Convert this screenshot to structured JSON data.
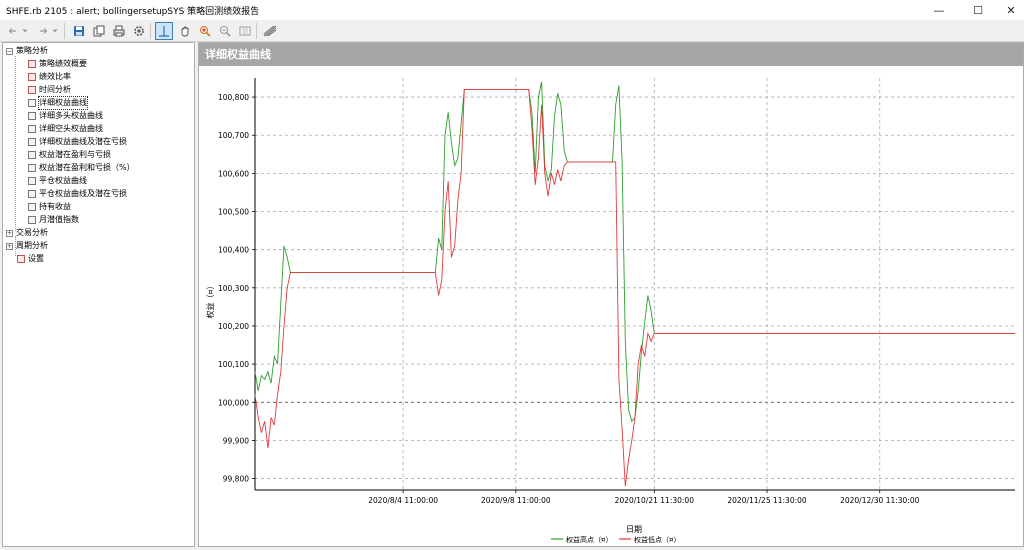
{
  "window": {
    "title": "SHFE.rb 2105 : alert; bollingersetupSYS 策略回测绩效报告",
    "minimize_glyph": "—",
    "maximize_glyph": "☐",
    "close_glyph": "✕"
  },
  "toolbar": {
    "icons": [
      "back-icon",
      "dropdown-icon",
      "forward-icon",
      "dropdown-icon",
      "save-icon",
      "copy-icon",
      "print-icon",
      "settings-icon",
      "crosshair-icon",
      "pan-icon",
      "zoom-in-icon",
      "zoom-out-icon",
      "reset-zoom-icon",
      "chart-style-icon"
    ]
  },
  "tree": {
    "root1": {
      "label": "策略分析",
      "expanded": true
    },
    "items": [
      "策略绩效概要",
      "绩效比率",
      "时间分析",
      "详细权益曲线",
      "详细多头权益曲线",
      "详细空头权益曲线",
      "详细权益曲线及潜在亏损",
      "权益潜在盈利与亏损",
      "权益潜在盈利和亏损（%）",
      "平仓权益曲线",
      "平仓权益曲线及潜在亏损",
      "持有收益",
      "月潜值指数"
    ],
    "selected_index": 3,
    "root2": {
      "label": "交易分析",
      "expanded": false
    },
    "root3": {
      "label": "周期分析",
      "expanded": false
    },
    "settings": {
      "label": "设置"
    }
  },
  "panel": {
    "title": "详细权益曲线"
  },
  "chart_data": {
    "type": "line",
    "xlabel": "日期",
    "ylabel": "权益（¤）",
    "ylim": [
      99770,
      100850
    ],
    "yticks": [
      99800,
      99900,
      100000,
      100100,
      100200,
      100300,
      100400,
      100500,
      100600,
      100700,
      100800
    ],
    "ytick_labels": [
      "99,800",
      "99,900",
      "100,000",
      "100,100",
      "100,200",
      "100,300",
      "100,400",
      "100,500",
      "100,600",
      "100,700",
      "100,800"
    ],
    "xlim": [
      "2020-06-19",
      "2021-02-10"
    ],
    "xticks": [
      "2020-08-04",
      "2020-09-08",
      "2020-10-21",
      "2020-11-25",
      "2020-12-30"
    ],
    "xtick_labels": [
      "2020/8/4 11:00:00",
      "2020/9/8 11:00:00",
      "2020/10/21 11:30:00",
      "2020/11/25 11:30:00",
      "2020/12/30 11:30:00"
    ],
    "grid": true,
    "legend_position": "bottom",
    "series": [
      {
        "name": "权益高点（¤）",
        "color": "#2e9e2e",
        "points": [
          [
            "2020-06-19",
            100080
          ],
          [
            "2020-06-20",
            100030
          ],
          [
            "2020-06-21",
            100070
          ],
          [
            "2020-06-22",
            100060
          ],
          [
            "2020-06-23",
            100080
          ],
          [
            "2020-06-24",
            100050
          ],
          [
            "2020-06-25",
            100120
          ],
          [
            "2020-06-26",
            100100
          ],
          [
            "2020-06-27",
            100260
          ],
          [
            "2020-06-28",
            100410
          ],
          [
            "2020-06-29",
            100380
          ],
          [
            "2020-06-30",
            100340
          ],
          [
            "2020-08-14",
            100340
          ],
          [
            "2020-08-15",
            100430
          ],
          [
            "2020-08-16",
            100400
          ],
          [
            "2020-08-17",
            100700
          ],
          [
            "2020-08-18",
            100760
          ],
          [
            "2020-08-19",
            100680
          ],
          [
            "2020-08-20",
            100620
          ],
          [
            "2020-08-21",
            100640
          ],
          [
            "2020-08-22",
            100730
          ],
          [
            "2020-08-23",
            100820
          ],
          [
            "2020-09-12",
            100820
          ],
          [
            "2020-09-13",
            100760
          ],
          [
            "2020-09-14",
            100600
          ],
          [
            "2020-09-15",
            100800
          ],
          [
            "2020-09-16",
            100840
          ],
          [
            "2020-09-17",
            100620
          ],
          [
            "2020-09-18",
            100580
          ],
          [
            "2020-09-19",
            100610
          ],
          [
            "2020-09-20",
            100750
          ],
          [
            "2020-09-21",
            100810
          ],
          [
            "2020-09-22",
            100780
          ],
          [
            "2020-09-23",
            100660
          ],
          [
            "2020-09-24",
            100630
          ],
          [
            "2020-10-08",
            100630
          ],
          [
            "2020-10-09",
            100780
          ],
          [
            "2020-10-10",
            100830
          ],
          [
            "2020-10-11",
            100630
          ],
          [
            "2020-10-12",
            100160
          ],
          [
            "2020-10-13",
            99980
          ],
          [
            "2020-10-14",
            99950
          ],
          [
            "2020-10-15",
            99960
          ],
          [
            "2020-10-16",
            100030
          ],
          [
            "2020-10-17",
            100130
          ],
          [
            "2020-10-18",
            100210
          ],
          [
            "2020-10-19",
            100280
          ],
          [
            "2020-10-20",
            100240
          ],
          [
            "2020-10-21",
            100180
          ],
          [
            "2021-02-10",
            100180
          ]
        ]
      },
      {
        "name": "权益低点（¤）",
        "color": "#e03a3a",
        "points": [
          [
            "2020-06-19",
            100020
          ],
          [
            "2020-06-20",
            99960
          ],
          [
            "2020-06-21",
            99920
          ],
          [
            "2020-06-22",
            99950
          ],
          [
            "2020-06-23",
            99880
          ],
          [
            "2020-06-24",
            99960
          ],
          [
            "2020-06-25",
            99940
          ],
          [
            "2020-06-26",
            100020
          ],
          [
            "2020-06-27",
            100080
          ],
          [
            "2020-06-28",
            100200
          ],
          [
            "2020-06-29",
            100300
          ],
          [
            "2020-06-30",
            100340
          ],
          [
            "2020-08-14",
            100340
          ],
          [
            "2020-08-15",
            100280
          ],
          [
            "2020-08-16",
            100320
          ],
          [
            "2020-08-17",
            100500
          ],
          [
            "2020-08-18",
            100580
          ],
          [
            "2020-08-19",
            100380
          ],
          [
            "2020-08-20",
            100410
          ],
          [
            "2020-08-21",
            100530
          ],
          [
            "2020-08-22",
            100600
          ],
          [
            "2020-08-23",
            100820
          ],
          [
            "2020-09-12",
            100820
          ],
          [
            "2020-09-13",
            100720
          ],
          [
            "2020-09-14",
            100570
          ],
          [
            "2020-09-15",
            100640
          ],
          [
            "2020-09-16",
            100780
          ],
          [
            "2020-09-17",
            100600
          ],
          [
            "2020-09-18",
            100540
          ],
          [
            "2020-09-19",
            100600
          ],
          [
            "2020-09-20",
            100570
          ],
          [
            "2020-09-21",
            100610
          ],
          [
            "2020-09-22",
            100580
          ],
          [
            "2020-09-23",
            100620
          ],
          [
            "2020-09-24",
            100630
          ],
          [
            "2020-10-08",
            100630
          ],
          [
            "2020-10-09",
            100630
          ],
          [
            "2020-10-10",
            100060
          ],
          [
            "2020-10-11",
            99930
          ],
          [
            "2020-10-12",
            99780
          ],
          [
            "2020-10-13",
            99850
          ],
          [
            "2020-10-14",
            99900
          ],
          [
            "2020-10-15",
            99960
          ],
          [
            "2020-10-16",
            100100
          ],
          [
            "2020-10-17",
            100150
          ],
          [
            "2020-10-18",
            100120
          ],
          [
            "2020-10-19",
            100180
          ],
          [
            "2020-10-20",
            100160
          ],
          [
            "2020-10-21",
            100180
          ],
          [
            "2021-02-10",
            100180
          ]
        ]
      }
    ]
  }
}
